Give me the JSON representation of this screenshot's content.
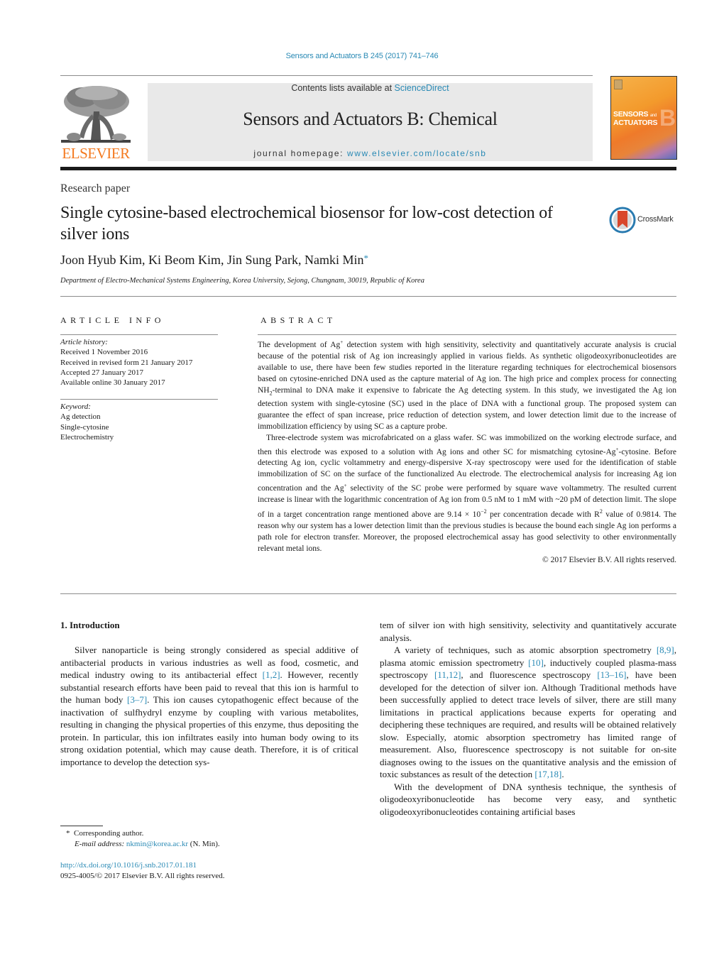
{
  "header": {
    "citation": "Sensors and Actuators B 245 (2017) 741–746",
    "contents_prefix": "Contents lists available at ",
    "contents_link": "ScienceDirect",
    "journal_title": "Sensors and Actuators B: Chemical",
    "homepage_prefix": "journal homepage: ",
    "homepage_link": "www.elsevier.com/locate/snb",
    "publisher_logo": "ELSEVIER",
    "cover": {
      "line1": "SENSORS",
      "and": "and",
      "line2": "ACTUATORS",
      "letter": "B"
    },
    "colors": {
      "link": "#2a8ab5",
      "elsevier_orange": "#f47a20",
      "banner_bg": "#e9e9e9"
    }
  },
  "article": {
    "type": "Research paper",
    "title": "Single cytosine-based electrochemical biosensor for low-cost detection of silver ions",
    "crossmark_label": "CrossMark",
    "authors": "Joon Hyub Kim, Ki Beom Kim, Jin Sung Park, Namki Min",
    "author_mark": "*",
    "affiliation": "Department of Electro-Mechanical Systems Engineering, Korea University, Sejong, Chungnam, 30019, Republic of Korea"
  },
  "article_info": {
    "heading": "ARTICLE INFO",
    "history_label": "Article history:",
    "history": [
      "Received 1 November 2016",
      "Received in revised form 21 January 2017",
      "Accepted 27 January 2017",
      "Available online 30 January 2017"
    ],
    "keywords_label": "Keyword:",
    "keywords": [
      "Ag detection",
      "Single-cytosine",
      "Electrochemistry"
    ]
  },
  "abstract": {
    "heading": "ABSTRACT",
    "p1": {
      "a": "The development of Ag",
      "sup1": "+",
      "b": " detection system with high sensitivity, selectivity and quantitatively accurate analysis is crucial because of the potential risk of Ag ion increasingly applied in various fields. As synthetic oligodeoxyribonucleotides are available to use, there have been few studies reported in the literature regarding techniques for electrochemical biosensors based on cytosine-enriched DNA used as the capture material of Ag ion. The high price and complex process for connecting NH",
      "sub1": "2",
      "c": "-terminal to DNA make it expensive to fabricate the Ag detecting system. In this study, we investigated the Ag ion detection system with single-cytosine (SC) used in the place of DNA with a functional group. The proposed system can guarantee the effect of span increase, price reduction of detection system, and lower detection limit due to the increase of immobilization efficiency by using SC as a capture probe."
    },
    "p2": {
      "a": "Three-electrode system was microfabricated on a glass wafer. SC was immobilized on the working electrode surface, and then this electrode was exposed to a solution with Ag ions and other SC for mismatching cytosine-Ag",
      "sup1": "+",
      "b": "-cytosine. Before detecting Ag ion, cyclic voltammetry and energy-dispersive X-ray spectroscopy were used for the identification of stable immobilization of SC on the surface of the functionalized Au electrode. The electrochemical analysis for increasing Ag ion concentration and the Ag",
      "sup2": "+",
      "c": " selectivity of the SC probe were performed by square wave voltammetry. The resulted current increase is linear with the logarithmic concentration of Ag ion from 0.5 nM to 1 mM with ~20 pM of detection limit. The slope of in a target concentration range mentioned above are 9.14 × 10",
      "sup3": "−2",
      "d": " per concentration decade with R",
      "sup4": "2",
      "e": " value of 0.9814. The reason why our system has a lower detection limit than the previous studies is because the bound each single Ag ion performs a path role for electron transfer. Moreover, the proposed electrochemical assay has good selectivity to other environmentally relevant metal ions."
    },
    "copyright": "© 2017 Elsevier B.V. All rights reserved."
  },
  "introduction": {
    "heading": "1.  Introduction",
    "left_p1": {
      "a": "Silver nanoparticle is being strongly considered as special additive of antibacterial products in various industries as well as food, cosmetic, and medical industry owing to its antibacterial effect ",
      "ref1": "[1,2]",
      "b": ". However, recently substantial research efforts have been paid to reveal that this ion is harmful to the human body ",
      "ref2": "[3–7]",
      "c": ". This ion causes cytopathogenic effect because of the inactivation of sulfhydryl enzyme by coupling with various metabolites, resulting in changing the physical properties of this enzyme, thus depositing the protein. In particular, this ion infiltrates easily into human body owing to its strong oxidation potential, which may cause death. Therefore, it is of critical importance to develop the detection sys-"
    },
    "right_cont": "tem of silver ion with high sensitivity, selectivity and quantitatively accurate analysis.",
    "right_p2": {
      "a": "A variety of techniques, such as atomic absorption spectrometry ",
      "ref1": "[8,9]",
      "b": ", plasma atomic emission spectrometry ",
      "ref2": "[10]",
      "c": ", inductively coupled plasma-mass spectroscopy ",
      "ref3": "[11,12]",
      "d": ", and fluorescence spectroscopy ",
      "ref4": "[13–16]",
      "e": ", have been developed for the detection of silver ion. Although Traditional methods have been successfully applied to detect trace levels of silver, there are still many limitations in practical applications because experts for operating and deciphering these techniques are required, and results will be obtained relatively slow. Especially, atomic absorption spectrometry has limited range of measurement. Also, fluorescence spectroscopy is not suitable for on-site diagnoses owing to the issues on the quantitative analysis and the emission of toxic substances as result of the detection ",
      "ref5": "[17,18]",
      "f": "."
    },
    "right_p3": "With the development of DNA synthesis technique, the synthesis of oligodeoxyribonucleotide has become very easy, and synthetic oligodeoxyribonucleotides containing artificial bases"
  },
  "footnote": {
    "mark": "*",
    "corresponding": "Corresponding author.",
    "email_label": "E-mail address: ",
    "email": "nkmin@korea.ac.kr",
    "email_suffix": " (N. Min)."
  },
  "doi": {
    "link": "http://dx.doi.org/10.1016/j.snb.2017.01.181",
    "issn": "0925-4005/© 2017 Elsevier B.V. All rights reserved."
  }
}
